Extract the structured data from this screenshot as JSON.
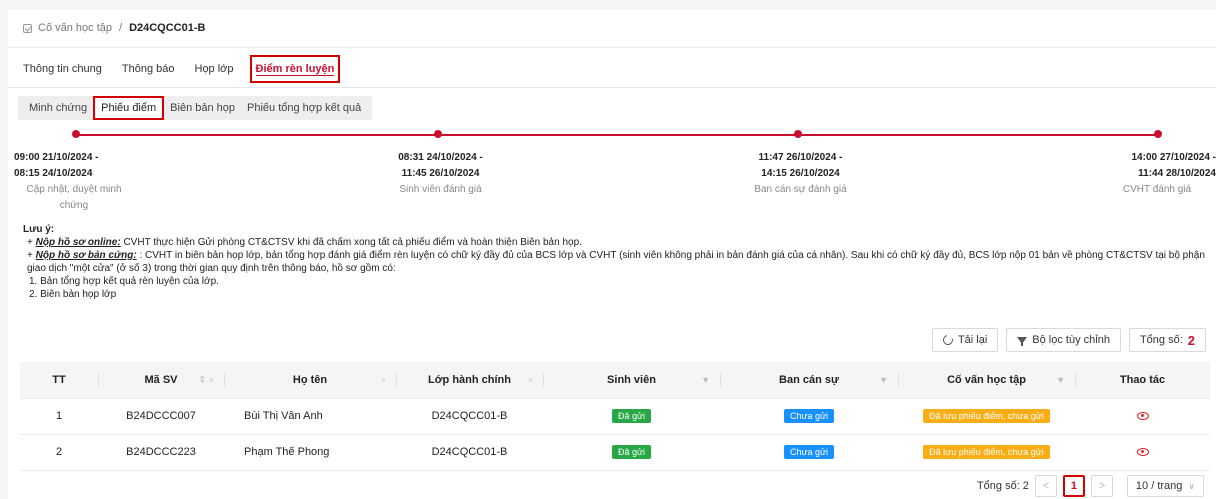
{
  "breadcrumb": {
    "root": "Cố vấn học tập",
    "separator": "/",
    "current": "D24CQCC01-B"
  },
  "tabs": [
    {
      "label": "Thông tin chung"
    },
    {
      "label": "Thông báo"
    },
    {
      "label": "Họp lớp"
    },
    {
      "label": "Điểm rèn luyện",
      "active": true
    }
  ],
  "subtabs": [
    {
      "label": "Minh chứng"
    },
    {
      "label": "Phiếu điểm",
      "active": true
    },
    {
      "label": "Biên bản họp"
    },
    {
      "label": "Phiếu tổng hợp kết quả"
    }
  ],
  "timeline": [
    {
      "start": "09:00 21/10/2024 -",
      "end": "08:15 24/10/2024",
      "desc": "Cập nhật, duyệt minh chứng"
    },
    {
      "start": "08:31 24/10/2024 -",
      "end": "11:45 26/10/2024",
      "desc": "Sinh viên đánh giá"
    },
    {
      "start": "11:47 26/10/2024 -",
      "end": "14:15 26/10/2024",
      "desc": "Ban cán sự đánh giá"
    },
    {
      "start": "14:00 27/10/2024 -",
      "end": "11:44 28/10/2024",
      "desc": "CVHT đánh giá"
    }
  ],
  "note": {
    "title": "Lưu ý:",
    "line1_prefix": "+ ",
    "line1_label": "Nộp hồ sơ online:",
    "line1_text": " CVHT thực hiện Gửi phòng CT&CTSV khi đã chấm xong tất cả phiếu điểm và hoàn thiện Biên bản họp.",
    "line2_prefix": "+ ",
    "line2_label": "Nộp hồ sơ bản cứng:",
    "line2_text": " : CVHT in biên bản họp lớp, bản tổng hợp đánh giá điểm rèn luyện có chữ ký đầy đủ của BCS lớp và CVHT (sinh viên không phải in bản đánh giá của cá nhân). Sau khi có chữ ký đầy đủ, BCS lớp nộp 01 bản về phòng CT&CTSV tại bộ phận giao dịch \"một cửa\" (ở số 3) trong thời gian quy định trên thông báo, hồ sơ gồm có:",
    "item1": "1. Bản tổng hợp kết quả rèn luyện của lớp.",
    "item2": "2. Biên bản họp lớp"
  },
  "toolbar": {
    "reload": "Tải lại",
    "filter": "Bộ lọc tùy chỉnh",
    "total_label": "Tổng số:",
    "total": "2"
  },
  "table": {
    "headers": [
      "TT",
      "Mã SV",
      "Họ tên",
      "Lớp hành chính",
      "Sinh viên",
      "Ban cán sự",
      "Cố vấn học tập",
      "Thao tác"
    ],
    "rows": [
      {
        "tt": "1",
        "ma_sv": "B24DCCC007",
        "ho_ten": "Bùi Thị Vân Anh",
        "lop": "D24CQCC01-B",
        "sv": "Đã gửi",
        "bcs": "Chưa gửi",
        "cvht": "Đã lưu phiếu điểm, chưa gửi"
      },
      {
        "tt": "2",
        "ma_sv": "B24DCCC223",
        "ho_ten": "Phạm Thế Phong",
        "lop": "D24CQCC01-B",
        "sv": "Đã gửi",
        "bcs": "Chưa gửi",
        "cvht": "Đã lưu phiếu điểm, chưa gửi"
      }
    ]
  },
  "pager": {
    "total_label": "Tổng số: 2",
    "prev": "<",
    "page": "1",
    "next": ">",
    "page_size": "10 / trang"
  },
  "colors": {
    "accent": "#c8102e",
    "green": "#27a745",
    "blue": "#1890ff",
    "orange": "#faad14"
  }
}
